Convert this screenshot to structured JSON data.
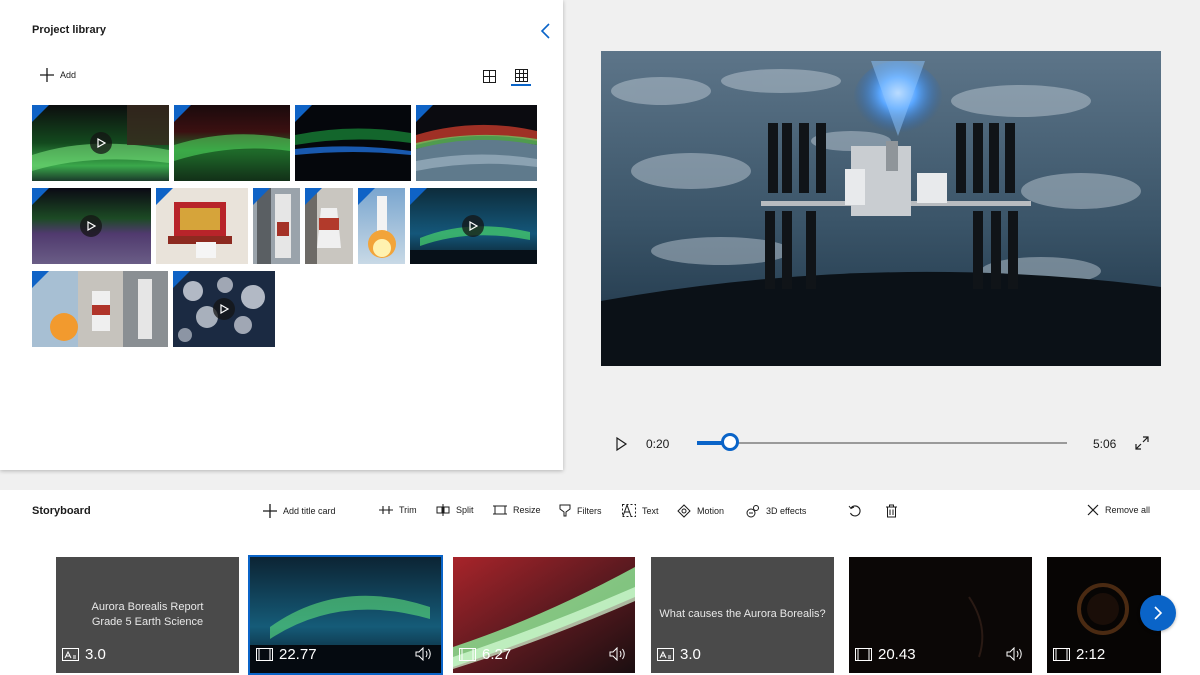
{
  "library": {
    "title": "Project library",
    "add_label": "Add",
    "views": [
      "large-thumbnails",
      "small-thumbnails"
    ]
  },
  "library_items": [
    {
      "type": "video",
      "scene": "aurora-green-over-earth"
    },
    {
      "type": "image",
      "scene": "aurora-green-horizon"
    },
    {
      "type": "image",
      "scene": "night-earth-blue-horizon"
    },
    {
      "type": "image",
      "scene": "aurora-red-earth-limb"
    },
    {
      "type": "video",
      "scene": "aurora-purple-night"
    },
    {
      "type": "image",
      "scene": "lunar-module-cleanroom"
    },
    {
      "type": "image",
      "scene": "rocket-on-pad-gantry"
    },
    {
      "type": "image",
      "scene": "rocket-close-up"
    },
    {
      "type": "image",
      "scene": "rocket-launch"
    },
    {
      "type": "video",
      "scene": "aurora-over-lake"
    },
    {
      "type": "image",
      "scene": "rocket-launch-collage"
    },
    {
      "type": "video",
      "scene": "earth-clouds-from-orbit"
    }
  ],
  "player": {
    "current_time": "0:20",
    "total_time": "5:06",
    "progress": 0.09
  },
  "storyboard": {
    "title": "Storyboard",
    "toolbar": {
      "add_title_card": "Add title card",
      "trim": "Trim",
      "split": "Split",
      "resize": "Resize",
      "filters": "Filters",
      "text": "Text",
      "motion": "Motion",
      "effects_3d": "3D effects",
      "remove_all": "Remove all"
    },
    "cards": [
      {
        "kind": "title",
        "lines": [
          "Aurora Borealis Report",
          "Grade 5 Earth Science"
        ],
        "duration": "3.0"
      },
      {
        "kind": "video",
        "duration": "22.77",
        "audio": true,
        "selected": true
      },
      {
        "kind": "video",
        "duration": "6.27",
        "audio": true
      },
      {
        "kind": "title",
        "lines": [
          "What causes the Aurora Borealis?"
        ],
        "duration": "3.0"
      },
      {
        "kind": "video",
        "duration": "20.43",
        "audio": true
      },
      {
        "kind": "video",
        "duration": "2:12",
        "audio": false
      }
    ]
  },
  "colors": {
    "accent": "#0a64c8",
    "panel_bg": "#ffffff",
    "app_bg": "#f0f0f0",
    "title_card_bg": "#4a4a4a"
  }
}
